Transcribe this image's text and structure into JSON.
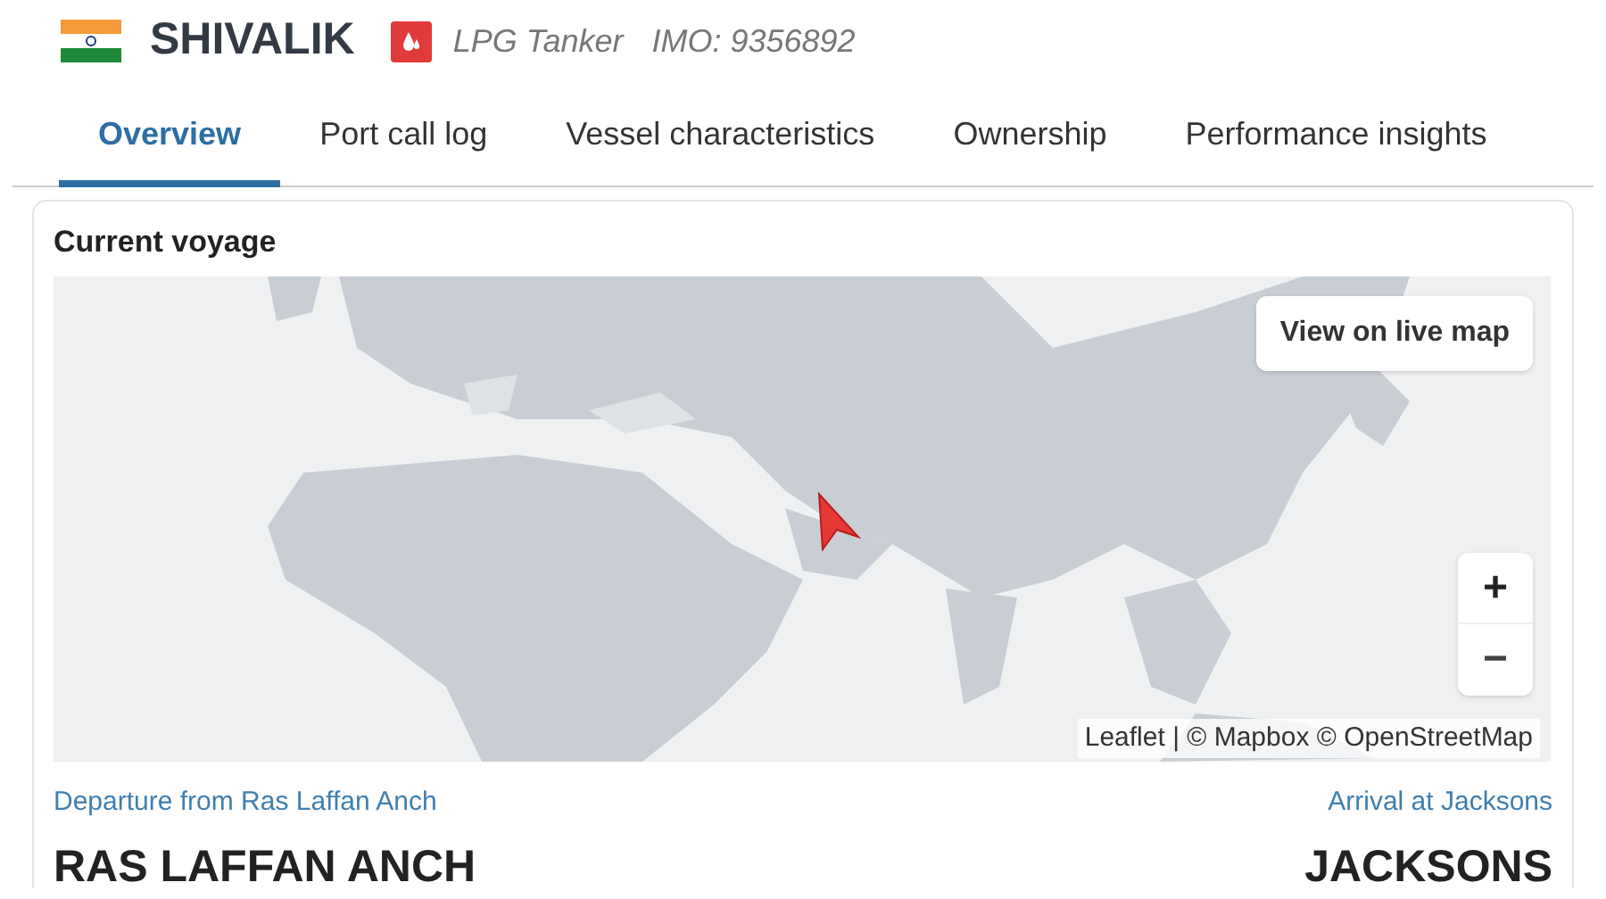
{
  "vessel": {
    "name": "SHIVALIK",
    "type": "LPG Tanker",
    "imo": "IMO: 9356892"
  },
  "tabs": [
    {
      "label": "Overview",
      "selected": true
    },
    {
      "label": "Port call log",
      "selected": false
    },
    {
      "label": "Vessel characteristics",
      "selected": false
    },
    {
      "label": "Ownership",
      "selected": false
    },
    {
      "label": "Performance insights",
      "selected": false
    }
  ],
  "voyage": {
    "title": "Current voyage",
    "map": {
      "live_button": "View on live map",
      "zoom_in": "+",
      "zoom_out": "−",
      "attribution": "Leaflet | © Mapbox © OpenStreetMap"
    },
    "departure": {
      "label": "Departure from Ras Laffan Anch",
      "port": "RAS LAFFAN ANCH"
    },
    "arrival": {
      "label": "Arrival at Jacksons",
      "port": "JACKSONS"
    }
  }
}
